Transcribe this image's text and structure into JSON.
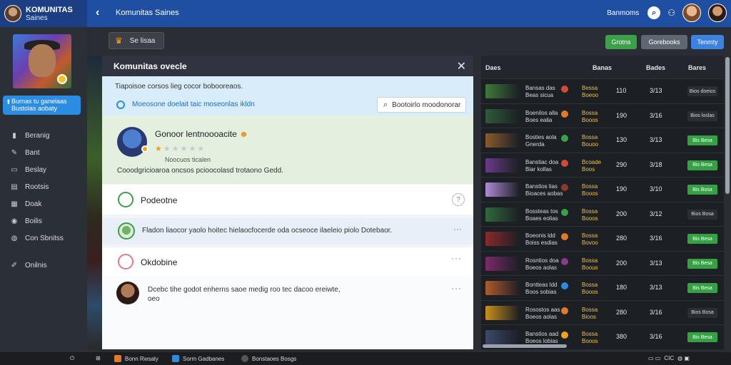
{
  "app": {
    "name": "KOMUNITAS",
    "subtitle": "Saines",
    "page_title": "Komunitas Saines"
  },
  "topbar": {
    "right_label": "Banmoms",
    "search_icon": "search-icon",
    "user_icon": "user-icon"
  },
  "sidebar": {
    "cta": "Burnas tu ganelaas\nBustolas aobaty",
    "items": [
      {
        "label": "Beranig",
        "icon": "chart-icon"
      },
      {
        "label": "Bant",
        "icon": "edit-icon"
      },
      {
        "label": "Beslay",
        "icon": "display-icon"
      },
      {
        "label": "Rootsis",
        "icon": "document-icon"
      },
      {
        "label": "Doak",
        "icon": "calendar-icon"
      },
      {
        "label": "Boilis",
        "icon": "globe-icon"
      },
      {
        "label": "Con Sbnitss",
        "icon": "people-icon"
      },
      {
        "label": "Onilnis",
        "icon": "settings-icon"
      }
    ]
  },
  "subheader": {
    "chip": "Se lisaa",
    "btn_green": "Grotns",
    "btn_gray": "Gorebooks",
    "btn_blue": "Tenmty"
  },
  "dialog": {
    "title": "Komunitas ovecle",
    "description": "Tiapoisoe corsos lieg cocor bobooreaos.",
    "link": "Moeosone doelait taic moseonlas ikldn",
    "search_label": "Bootoirlo moodonorar",
    "profile": {
      "name": "Gonoor lentnoooacite",
      "stars_on": "★",
      "stars_off": "★★★★★",
      "sub": "Noocuos ticalen",
      "line": "Cooodgricioaroa oncsos pcioocolasd trotaono Gedd."
    },
    "section1": {
      "title": "Podeotne",
      "help": "?"
    },
    "message": {
      "text": "Fladon liaocor yaolo hoitec hielaocfocerde oda ocseoce ilaeleio piolo Dotebaor."
    },
    "section2": {
      "title": "Okdobine"
    },
    "comment": {
      "line1": "Dcebc tihe godot enherns saoe medig roo tec dacoo ereiwte,",
      "line2": "oeo"
    }
  },
  "table": {
    "headers": [
      "Daes",
      "Banas",
      "Bades",
      "Bares"
    ],
    "rows": [
      {
        "name": "Bansas das\nBeas sicua",
        "team": "Bessa\nBoeoo",
        "v1": "110",
        "v2": "3/13",
        "tag": "Bios doeios",
        "tag_style": "dark",
        "color": "#3f7a3a"
      },
      {
        "name": "Boenilos alla\nBoes ealia",
        "team": "Bossa\nBooos",
        "v1": "190",
        "v2": "3/16",
        "tag": "Bios loslas",
        "tag_style": "dark",
        "color": "#2f5a3a"
      },
      {
        "name": "Bosties aola\nGnerda",
        "team": "Bossa\nBouoo",
        "v1": "130",
        "v2": "3/13",
        "tag": "Bis Besa",
        "tag_style": "green",
        "color": "#8a5a2a"
      },
      {
        "name": "Banstiac doa\nBiar kollas",
        "team": "Bcoade\nBoos",
        "v1": "290",
        "v2": "3/18",
        "tag": "Bis Besa",
        "tag_style": "green",
        "color": "#6a3a8a"
      },
      {
        "name": "Banstios lias\nBioaces aobas",
        "team": "Bossa\nBooos",
        "v1": "190",
        "v2": "3/10",
        "tag": "Bis Bosa",
        "tag_style": "green",
        "color": "#b08ad8"
      },
      {
        "name": "Bossteas tos\nBoaes eolias",
        "team": "Bossa\nBooos",
        "v1": "200",
        "v2": "3/12",
        "tag": "Bios Bosa",
        "tag_style": "dark",
        "color": "#2f6a3a"
      },
      {
        "name": "Boeonis ldd\nBoiss esdias",
        "team": "Bossa\nBovoo",
        "v1": "280",
        "v2": "3/16",
        "tag": "Bis Besa",
        "tag_style": "green",
        "color": "#8a2a2a"
      },
      {
        "name": "Rosntios doa\nBoeos aolas",
        "team": "Bossa\nBoous",
        "v1": "200",
        "v2": "3/13",
        "tag": "Bis Besa",
        "tag_style": "green",
        "color": "#7a2a6a"
      },
      {
        "name": "Bontteas ldd\nBoos sobias",
        "team": "Bossa\nBooos",
        "v1": "180",
        "v2": "3/13",
        "tag": "Bis Besa",
        "tag_style": "green",
        "color": "#b05a2a"
      },
      {
        "name": "Rosostos aas\nBoeos aolas",
        "team": "Bossa\nBioos",
        "v1": "280",
        "v2": "3/16",
        "tag": "Bios Bosa",
        "tag_style": "dark",
        "color": "#c8901a"
      },
      {
        "name": "Banstios aad\nBoeos lobias",
        "team": "Bossa\nBooos",
        "v1": "380",
        "v2": "3/16",
        "tag": "Bis Besa",
        "tag_style": "green",
        "color": "#3a4a6a"
      }
    ]
  },
  "taskbar": {
    "items": [
      "Bonn Rwsaly",
      "Sorm Gadbanes",
      "Bonstaoes Bosgs"
    ],
    "clock": "CIC"
  }
}
